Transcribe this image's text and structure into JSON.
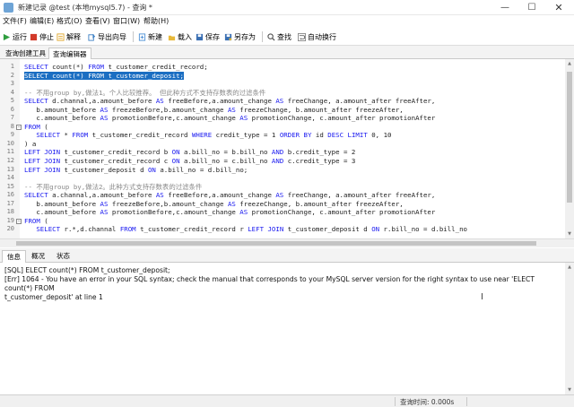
{
  "window": {
    "title": "新建记录 @test (本地mysql5.7) - 查询 *",
    "minimize": "—",
    "maximize": "☐",
    "close": "✕"
  },
  "menu": {
    "items": [
      "文件(F)",
      "编辑(E)",
      "格式(O)",
      "查看(V)",
      "窗口(W)",
      "帮助(H)"
    ]
  },
  "toolbar": {
    "buttons": [
      {
        "label": "运行",
        "icon": "run-icon",
        "color": "#2f9e3f"
      },
      {
        "label": "停止",
        "icon": "stop-icon",
        "color": "#d23a2a"
      },
      {
        "label": "解释",
        "icon": "explain-icon",
        "color": "#e0a52a"
      },
      {
        "label": "导出向导",
        "icon": "export-icon",
        "color": "#3b7fc4"
      },
      {
        "label": "新建",
        "icon": "new-icon",
        "color": "#4c8fd6"
      },
      {
        "label": "载入",
        "icon": "load-icon",
        "color": "#e8b93a"
      },
      {
        "label": "保存",
        "icon": "save-icon",
        "color": "#3a6fb3"
      },
      {
        "label": "另存为",
        "icon": "save-as-icon",
        "color": "#3a6fb3"
      },
      {
        "label": "查找",
        "icon": "find-icon",
        "color": "#555555"
      },
      {
        "label": "自动换行",
        "icon": "wrap-icon",
        "color": "#666666"
      }
    ]
  },
  "tabs": {
    "items": [
      "查询创建工具",
      "查询编辑器"
    ],
    "active": 1
  },
  "editor": {
    "highlight_color": "#1b6ec2",
    "keyword_color": "#1a1af0",
    "comment_color": "#8a8a8a",
    "lines": [
      "SELECT count(*) FROM t_customer_credit_record;",
      "SELECT count(*) FROM t_customer_deposit;",
      "",
      "-- 不用group by,做法1。个人比较推荐。 但此种方式不支持存数表的过滤条件",
      "SELECT d.channal,a.amount_before AS freeBefore,a.amount_change AS freeChange, a.amount_after freeAfter,",
      "   b.amount_before AS freezeBefore,b.amount_change AS freezeChange, b.amount_after freezeAfter,",
      "   c.amount_before AS promotionBefore,c.amount_change AS promotionChange, c.amount_after promotionAfter",
      "FROM (",
      "   SELECT * FROM t_customer_credit_record WHERE credit_type = 1 ORDER BY id DESC LIMIT 0, 10",
      ") a",
      "LEFT JOIN t_customer_credit_record b ON a.bill_no = b.bill_no AND b.credit_type = 2",
      "LEFT JOIN t_customer_credit_record c ON a.bill_no = c.bill_no AND c.credit_type = 3",
      "LEFT JOIN t_customer_deposit d ON a.bill_no = d.bill_no;",
      "",
      "-- 不用group by,做法2。此种方式支持存数表的过滤条件",
      "SELECT a.channal,a.amount_before AS freeBefore,a.amount_change AS freeChange, a.amount_after freeAfter,",
      "   b.amount_before AS freezeBefore,b.amount_change AS freezeChange, b.amount_after freezeAfter,",
      "   c.amount_before AS promotionBefore,c.amount_change AS promotionChange, c.amount_after promotionAfter",
      "FROM (",
      "   SELECT r.*,d.channal FROM t_customer_credit_record r LEFT JOIN t_customer_deposit d ON r.bill_no = d.bill_no"
    ],
    "line_numbers": [
      "1",
      "2",
      "3",
      "4",
      "5",
      "6",
      "7",
      "8",
      "9",
      "10",
      "11",
      "12",
      "13",
      "14",
      "15",
      "16",
      "17",
      "18",
      "19",
      "20"
    ]
  },
  "bottom_tabs": {
    "items": [
      "信息",
      "概况",
      "状态"
    ],
    "active": 0
  },
  "message": {
    "lines": [
      "[SQL] ELECT count(*) FROM t_customer_deposit;",
      "[Err] 1064 - You have an error in your SQL syntax; check the manual that corresponds to your MySQL server version for the right syntax to use near 'ELECT count(*) FROM",
      "t_customer_deposit' at line 1"
    ]
  },
  "status": {
    "query_time": "查询时间: 0.000s"
  }
}
